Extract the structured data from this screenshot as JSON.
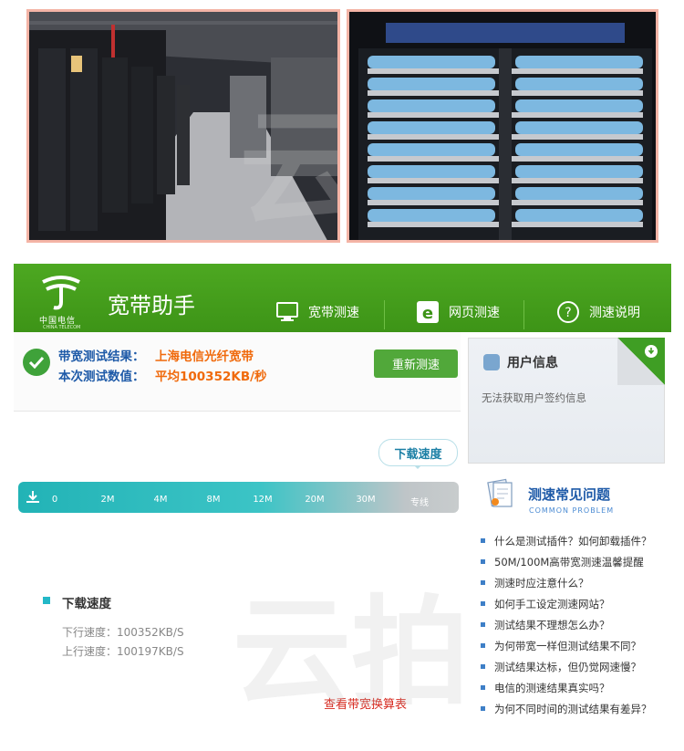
{
  "app": {
    "logo_text": "中国电信",
    "logo_sub": "CHINA TELECOM",
    "title": "宽带助手"
  },
  "nav": [
    {
      "label": "宽带测速",
      "icon": "monitor-icon"
    },
    {
      "label": "网页测速",
      "icon": "ie-browser-icon"
    },
    {
      "label": "测速说明",
      "icon": "question-icon"
    }
  ],
  "result": {
    "result_label": "带宽测试结果：",
    "result_value": "上海电信光纤宽带",
    "value_label": "本次测试数值：",
    "value_value": "平均100352KB/秒",
    "retest_button": "重新测速"
  },
  "speedometer": {
    "bubble": "下载速度",
    "ticks": [
      "0",
      "2M",
      "4M",
      "8M",
      "12M",
      "20M",
      "30M",
      "专线"
    ]
  },
  "speed": {
    "title": "下载速度",
    "down": "下行速度：100352KB/S",
    "up": "上行速度：100197KB/S",
    "conversion_link": "查看带宽换算表"
  },
  "user_info": {
    "title": "用户信息",
    "message": "无法获取用户签约信息"
  },
  "faq": {
    "title": "测速常见问题",
    "subtitle": "COMMON PROBLEM",
    "items": [
      "什么是测试插件？如何卸载插件？",
      "50M/100M高带宽测速温馨提醒",
      "测速时应注意什么？",
      "如何手工设定测速网站？",
      "测试结果不理想怎么办？",
      "为何带宽一样但测试结果不同？",
      "测试结果达标，但仍觉网速慢？",
      "电信的测速结果真实吗？",
      "为何不同时间的测试结果有差异？"
    ]
  },
  "watermark": "云拍",
  "colors": {
    "header_green": "#4da821",
    "accent_orange": "#f06a0c",
    "label_blue": "#1e5aa8",
    "link_red": "#d6281e",
    "speedbar_teal": "#22b3b6"
  }
}
